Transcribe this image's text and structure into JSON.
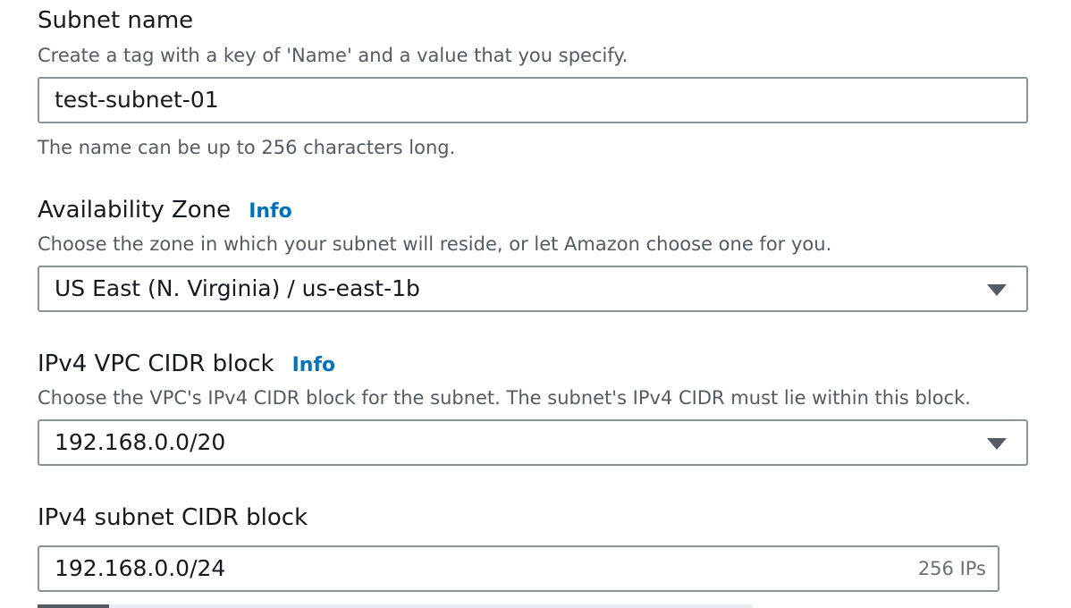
{
  "subnet_name": {
    "label": "Subnet name",
    "description": "Create a tag with a key of 'Name' and a value that you specify.",
    "value": "test-subnet-01",
    "constraint": "The name can be up to 256 characters long."
  },
  "availability_zone": {
    "label": "Availability Zone",
    "info_link": "Info",
    "description": "Choose the zone in which your subnet will reside, or let Amazon choose one for you.",
    "selected": "US East (N. Virginia) / us-east-1b"
  },
  "vpc_cidr": {
    "label": "IPv4 VPC CIDR block",
    "info_link": "Info",
    "description": "Choose the VPC's IPv4 CIDR block for the subnet. The subnet's IPv4 CIDR must lie within this block.",
    "selected": "192.168.0.0/20"
  },
  "subnet_cidr": {
    "label": "IPv4 subnet CIDR block",
    "value": "192.168.0.0/24",
    "suffix": "256 IPs",
    "range_fraction": 0.1
  },
  "colors": {
    "info_link": "#0073bb",
    "border": "#879596",
    "description_text": "#545b64"
  }
}
